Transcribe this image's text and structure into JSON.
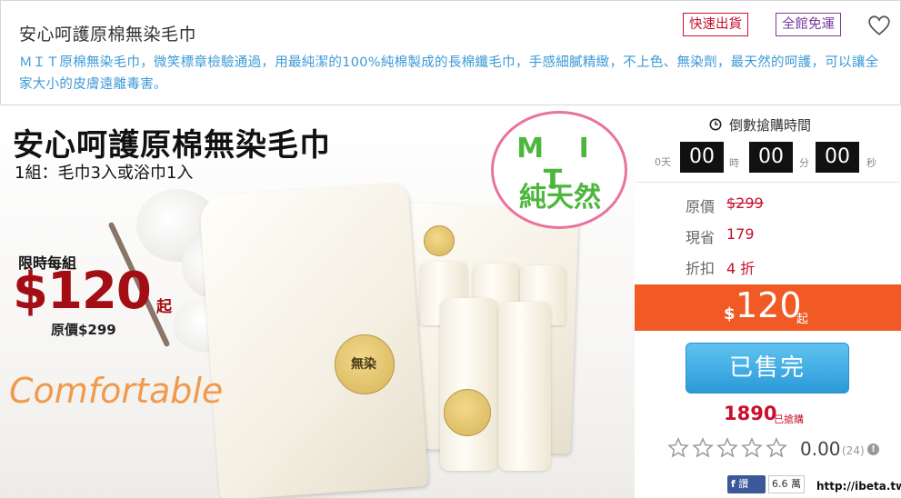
{
  "header": {
    "title": "安心呵護原棉無染毛巾",
    "description": "ＭＩＴ原棉無染毛巾，微笑標章檢驗通過，用最純潔的100%純棉製成的長棉纖毛巾，手感細膩精緻，不上色、無染劑，最天然的呵護，可以讓全家大小的皮膚遠離毒害。",
    "tags": [
      "快速出貨",
      "全館免運"
    ],
    "favorite_icon": "heart-icon"
  },
  "banner": {
    "title": "安心呵護原棉無染毛巾",
    "subtitle": "1組：毛巾3入或浴巾1入",
    "limit_label": "限時每組",
    "price": "$120",
    "price_suffix": "起",
    "original_price": "原價$299",
    "tagline": "Comfortable",
    "badge_top": "M I T",
    "badge_bottom": "純天然",
    "seal_text": "無染"
  },
  "countdown": {
    "label": "倒數搶購時間",
    "days": "0",
    "days_unit": "天",
    "hours": "00",
    "hours_unit": "時",
    "minutes": "00",
    "minutes_unit": "分",
    "seconds": "00",
    "seconds_unit": "秒"
  },
  "pricing": {
    "original_label": "原價",
    "original_value": "$299",
    "save_label": "現省",
    "save_value": "179",
    "discount_label": "折扣",
    "discount_value": "4 折",
    "price_symbol": "$",
    "price_value": "120",
    "price_suffix": "起"
  },
  "purchase": {
    "button_label": "已售完",
    "sold_count": "1890",
    "sold_label": "已搶購"
  },
  "rating": {
    "score": "0.00",
    "count": "(24)",
    "stars_filled": 0,
    "stars_total": 5
  },
  "social": {
    "fb_label": "讚",
    "fb_count": "6.6 萬"
  },
  "watermark": "http://ibeta.tw",
  "colors": {
    "accent_orange": "#f15a24",
    "button_blue": "#2b9ad8",
    "price_red": "#c8102e",
    "description_blue": "#3b9ad8"
  }
}
